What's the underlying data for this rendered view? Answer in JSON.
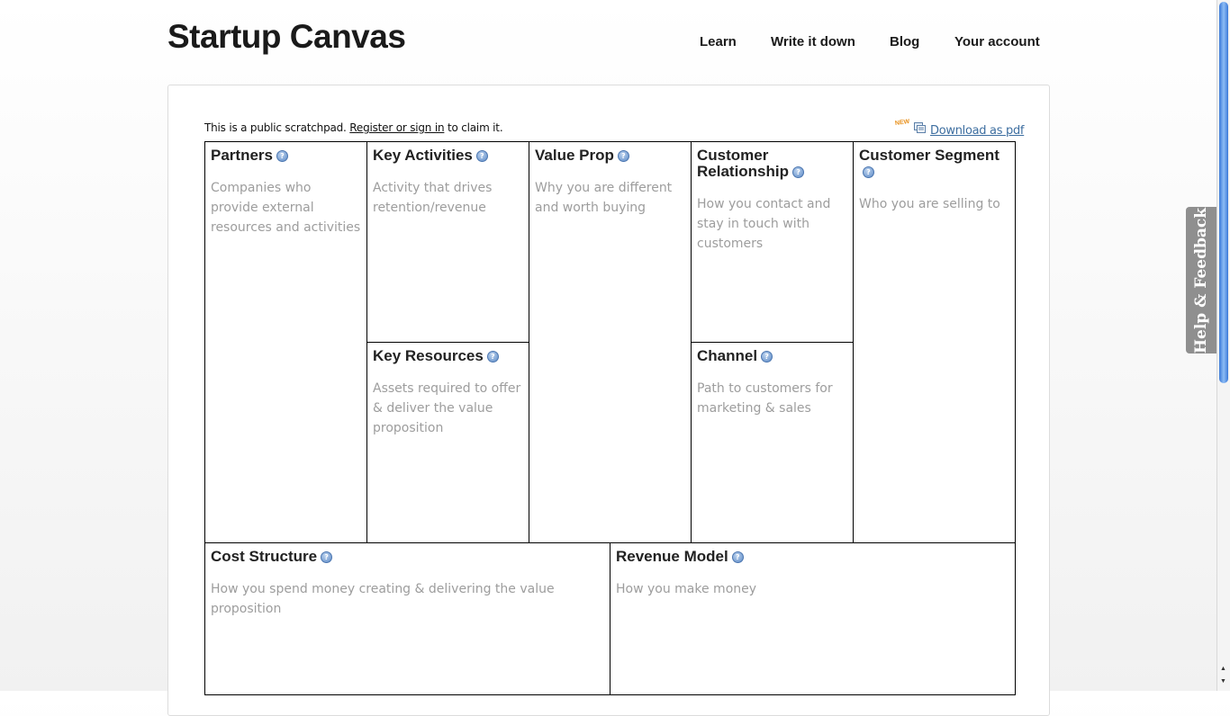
{
  "header": {
    "logo": "Startup Canvas",
    "nav": [
      "Learn",
      "Write it down",
      "Blog",
      "Your account"
    ]
  },
  "notice": {
    "prefix": "This is a public scratchpad. ",
    "link": "Register or sign in",
    "suffix": " to claim it."
  },
  "download": {
    "badge": "NEW",
    "label": "Download as pdf"
  },
  "canvas": {
    "partners": {
      "title": "Partners",
      "hint": "Companies who provide external resources and activities"
    },
    "key_activities": {
      "title": "Key Activities",
      "hint": "Activity that drives retention/revenue"
    },
    "key_resources": {
      "title": "Key Resources",
      "hint": "Assets required to offer & deliver the value proposition"
    },
    "value_prop": {
      "title": "Value Prop",
      "hint": "Why you are different and worth buying"
    },
    "customer_relationship": {
      "title": "Customer Relationship",
      "hint": "How you contact and stay in touch with customers"
    },
    "channel": {
      "title": "Channel",
      "hint": "Path to customers for marketing & sales"
    },
    "customer_segment": {
      "title": "Customer Segment",
      "hint": "Who you are selling to"
    },
    "cost_structure": {
      "title": "Cost Structure",
      "hint": "How you spend money creating & delivering the value proposition"
    },
    "revenue_model": {
      "title": "Revenue Model",
      "hint": "How you make money"
    }
  },
  "feedback_tab": "Help & Feedback",
  "help_glyph": "?"
}
